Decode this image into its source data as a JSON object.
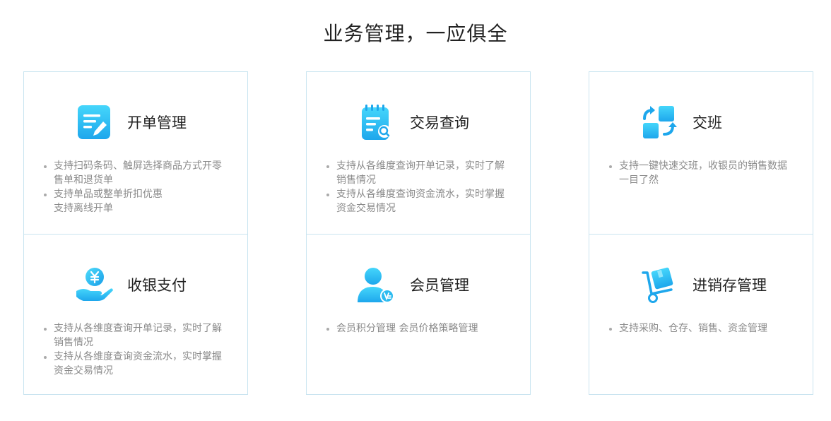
{
  "page": {
    "title": "业务管理，一应俱全"
  },
  "features": [
    {
      "title": "开单管理",
      "icon": "document-edit-icon",
      "items": [
        "支持扫码条码、触屏选择商品方式开零售单和退货单",
        "支持单品或整单折扣优惠",
        "支持离线开单"
      ]
    },
    {
      "title": "收银支付",
      "icon": "yen-hand-icon",
      "items": [
        "支持从各维度查询开单记录，实时了解销售情况",
        "支持从各维度查询资金流水，实时掌握资金交易情况"
      ]
    },
    {
      "title": "交易查询",
      "icon": "notepad-search-icon",
      "items": [
        "支持从各维度查询开单记录，实时了解销售情况",
        "支持从各维度查询资金流水，实时掌握资金交易情况"
      ]
    },
    {
      "title": "会员管理",
      "icon": "member-user-icon",
      "items": [
        "会员积分管理 会员价格策略管理"
      ]
    },
    {
      "title": "交班",
      "icon": "shift-exchange-icon",
      "items": [
        "支持一键快速交班，收银员的销售数据一目了然"
      ]
    },
    {
      "title": "进销存管理",
      "icon": "hand-truck-box-icon",
      "items": [
        "支持采购、仓存、销售、资金管理"
      ]
    }
  ],
  "colors": {
    "accent": "#2ec8f5",
    "accent_dark": "#1aa8e6",
    "border": "#c9e4f0",
    "text_muted": "#8a8a8a"
  }
}
